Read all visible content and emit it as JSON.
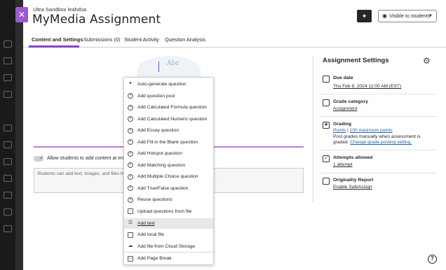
{
  "header": {
    "course_name": "Ultra Sandbox leahdsa",
    "title": "MyMedia Assignment",
    "visibility_label": "Visible to students",
    "close_icon": "close-icon",
    "magic_icon": "sparkle-icon"
  },
  "tabs": [
    {
      "label": "Content and Settings"
    },
    {
      "label": "Submissions (0)"
    },
    {
      "label": "Student Activity"
    },
    {
      "label": "Question Analysis"
    }
  ],
  "content": {
    "illustration_text": "Abc",
    "allow_label": "Allow students to add content at enc",
    "stub_placeholder": "Students can add text, images, and files he"
  },
  "menu": {
    "items": [
      {
        "label": "Auto-generate question",
        "icon": "sparkle-icon"
      },
      {
        "label": "Add question pool",
        "icon": "plus-circle-icon"
      },
      {
        "label": "Add Calculated Formula question",
        "icon": "plus-circle-icon"
      },
      {
        "label": "Add Calculated Numeric question",
        "icon": "plus-circle-icon"
      },
      {
        "label": "Add Essay question",
        "icon": "plus-circle-icon"
      },
      {
        "label": "Add Fill in the Blank question",
        "icon": "plus-circle-icon"
      },
      {
        "label": "Add Hotspot question",
        "icon": "plus-circle-icon"
      },
      {
        "label": "Add Matching question",
        "icon": "plus-circle-icon"
      },
      {
        "label": "Add Multiple Choice question",
        "icon": "plus-circle-icon"
      },
      {
        "label": "Add True/False question",
        "icon": "plus-circle-icon"
      },
      {
        "label": "Reuse questions",
        "icon": "plus-circle-icon"
      },
      {
        "label": "Upload questions from file",
        "icon": "file-upload-icon"
      },
      {
        "label": "Add text",
        "icon": "text-icon"
      },
      {
        "label": "Add local file",
        "icon": "file-icon"
      },
      {
        "label": "Add file from Cloud Storage",
        "icon": "cloud-icon"
      },
      {
        "label": "Add Page Break",
        "icon": "page-break-icon"
      }
    ]
  },
  "settings": {
    "title": "Assignment Settings",
    "due_date": {
      "heading": "Due date",
      "value": "Thu Feb 8, 2024 12:00 AM (EST)"
    },
    "grade_category": {
      "heading": "Grade category",
      "value": "Assignment"
    },
    "grading": {
      "heading": "Grading",
      "points_link": "Points",
      "separator": "|",
      "max_link": "100 maximum points",
      "note_line1": "Post grades manually when assessment is",
      "note_line2_prefix": "graded.",
      "note_link": "Change grade posting setting."
    },
    "attempts": {
      "heading": "Attempts allowed",
      "value": "1 attempt"
    },
    "originality": {
      "heading": "Originality Report",
      "value": "Enable SafeAssign"
    }
  },
  "help_icon": "help-icon"
}
